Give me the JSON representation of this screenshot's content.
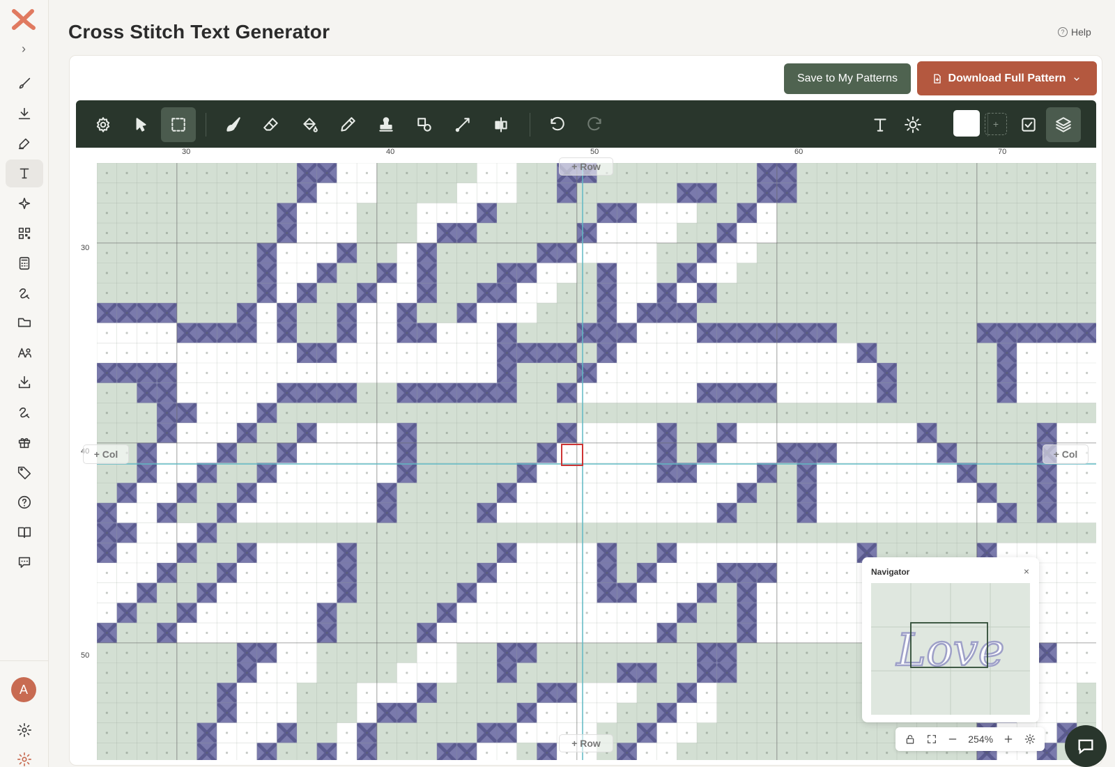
{
  "app": {
    "title": "Cross Stitch Text Generator",
    "help_label": "Help"
  },
  "sidebar": {
    "items": [
      {
        "icon": "brush-icon"
      },
      {
        "icon": "download-icon"
      },
      {
        "icon": "edit-icon"
      },
      {
        "icon": "text-icon",
        "active": true
      },
      {
        "icon": "sparkle-icon"
      },
      {
        "icon": "qr-code-icon"
      },
      {
        "icon": "calculator-icon"
      },
      {
        "icon": "thread-icon"
      },
      {
        "icon": "folder-icon"
      },
      {
        "icon": "font-user-icon"
      },
      {
        "icon": "download-tray-icon"
      },
      {
        "icon": "thread-icon"
      },
      {
        "icon": "gift-icon"
      },
      {
        "icon": "tag-icon"
      },
      {
        "icon": "help-circle-icon"
      },
      {
        "icon": "book-icon"
      },
      {
        "icon": "chat-icon"
      }
    ],
    "avatar_initial": "A"
  },
  "actions": {
    "save_label": "Save to My Patterns",
    "download_label": "Download Full Pattern"
  },
  "toolbar": {
    "tools": [
      "settings",
      "select",
      "marquee",
      "brush",
      "eraser",
      "fill",
      "eyedropper",
      "stamp",
      "shapes",
      "line",
      "mirror",
      "undo",
      "redo",
      "text",
      "brightness",
      "swatch",
      "add-color",
      "check",
      "layers"
    ],
    "active_tool": "marquee"
  },
  "canvas": {
    "col_ticks": [
      "30",
      "40",
      "50",
      "60",
      "70"
    ],
    "row_ticks": [
      "30",
      "40",
      "50"
    ],
    "add_row_label": "+ Row",
    "add_col_label": "+ Col",
    "colors": {
      "background": "#d3dfd3",
      "stitch": "#7a7aac",
      "white_stitch": "#ffffff",
      "guide": "#5fb8c4",
      "cursor": "#cc3333"
    }
  },
  "navigator": {
    "title": "Navigator",
    "close": "×",
    "preview_text": "Love"
  },
  "zoom": {
    "value": "254%"
  },
  "colors": {
    "brand": "#b4583f",
    "toolbar": "#29362c",
    "save_button": "#4f6350"
  }
}
